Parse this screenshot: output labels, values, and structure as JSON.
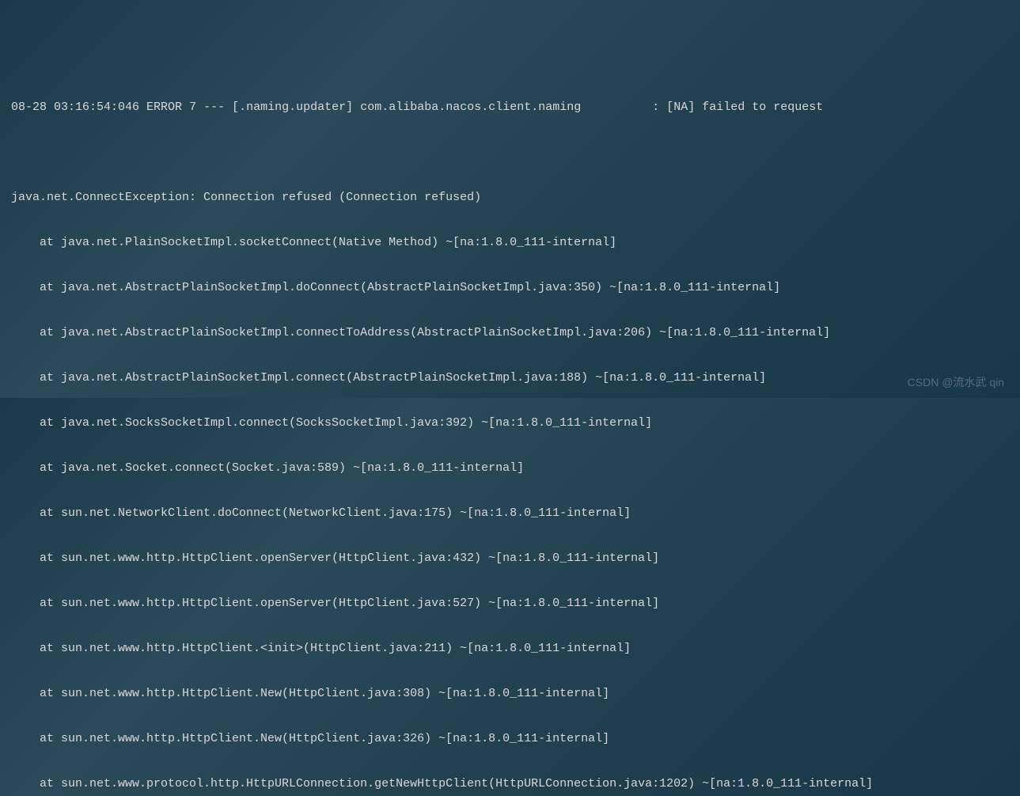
{
  "header": {
    "timestamp": "08-28 03:16:54:046",
    "level": "ERROR",
    "pid": "7",
    "separator": "---",
    "thread": "[.naming.updater]",
    "logger": "com.alibaba.nacos.client.naming",
    "colon": ":",
    "message": "[NA] failed to request"
  },
  "exception": {
    "class_message": "java.net.ConnectException: Connection refused (Connection refused)"
  },
  "stack": [
    "at java.net.PlainSocketImpl.socketConnect(Native Method) ~[na:1.8.0_111-internal]",
    "at java.net.AbstractPlainSocketImpl.doConnect(AbstractPlainSocketImpl.java:350) ~[na:1.8.0_111-internal]",
    "at java.net.AbstractPlainSocketImpl.connectToAddress(AbstractPlainSocketImpl.java:206) ~[na:1.8.0_111-internal]",
    "at java.net.AbstractPlainSocketImpl.connect(AbstractPlainSocketImpl.java:188) ~[na:1.8.0_111-internal]",
    "at java.net.SocksSocketImpl.connect(SocksSocketImpl.java:392) ~[na:1.8.0_111-internal]",
    "at java.net.Socket.connect(Socket.java:589) ~[na:1.8.0_111-internal]",
    "at sun.net.NetworkClient.doConnect(NetworkClient.java:175) ~[na:1.8.0_111-internal]",
    "at sun.net.www.http.HttpClient.openServer(HttpClient.java:432) ~[na:1.8.0_111-internal]",
    "at sun.net.www.http.HttpClient.openServer(HttpClient.java:527) ~[na:1.8.0_111-internal]",
    "at sun.net.www.http.HttpClient.<init>(HttpClient.java:211) ~[na:1.8.0_111-internal]",
    "at sun.net.www.http.HttpClient.New(HttpClient.java:308) ~[na:1.8.0_111-internal]",
    "at sun.net.www.http.HttpClient.New(HttpClient.java:326) ~[na:1.8.0_111-internal]",
    "at sun.net.www.protocol.http.HttpURLConnection.getNewHttpClient(HttpURLConnection.java:1202) ~[na:1.8.0_111-internal]"
  ],
  "watermark": "CSDN @流水武 qin"
}
